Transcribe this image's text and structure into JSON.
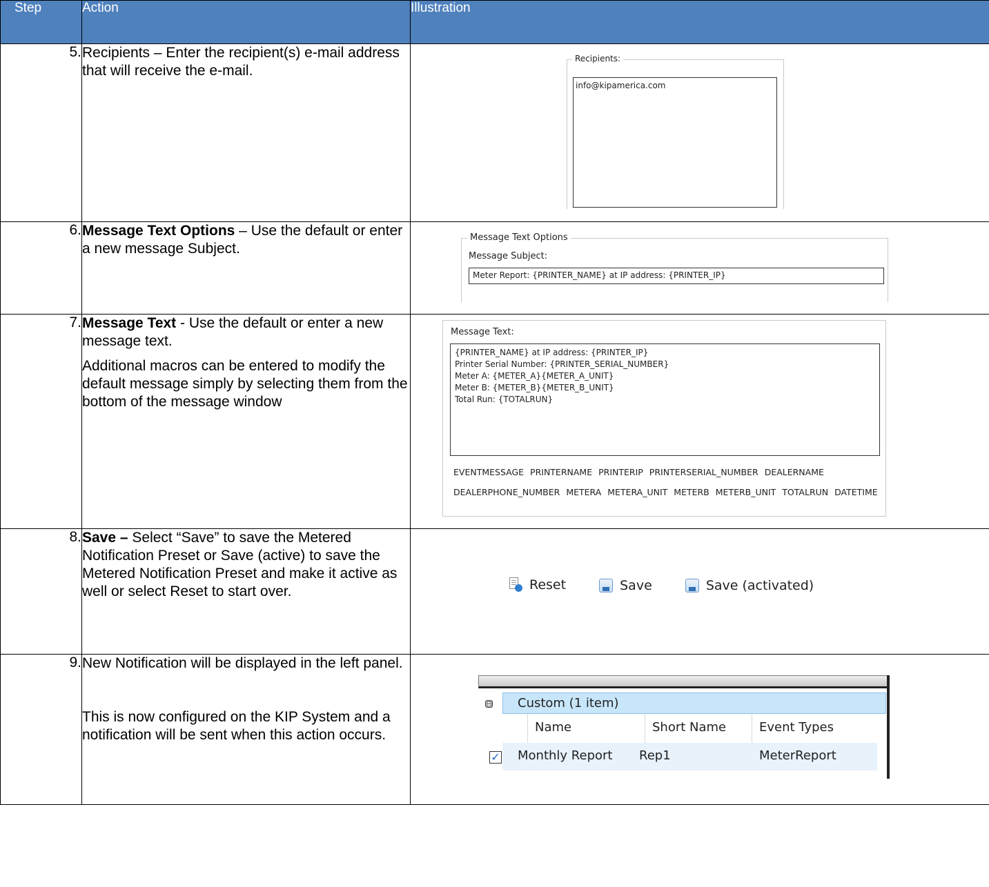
{
  "headers": {
    "step": "Step",
    "action": "Action",
    "illustration": "Illustration"
  },
  "rows": [
    {
      "step": "5.",
      "action_bold": "",
      "action_text": "Recipients – Enter the recipient(s) e-mail address that will receive the e-mail.",
      "illustration": {
        "legend": "Recipients:",
        "value": "info@kipamerica.com"
      }
    },
    {
      "step": "6.",
      "action_bold": "Message Text Options",
      "action_text": " – Use the default or enter a new message Subject.",
      "illustration": {
        "legend": "Message Text Options",
        "subject_label": "Message Subject:",
        "subject_value": "Meter Report: {PRINTER_NAME} at IP address: {PRINTER_IP}"
      }
    },
    {
      "step": "7.",
      "action_bold": "Message Text",
      "action_text": " - Use the default or enter a new message text.",
      "action_text_2": "Additional macros can be entered to modify the default message simply by selecting them from the bottom of the message window",
      "illustration": {
        "label": "Message Text:",
        "lines": [
          "{PRINTER_NAME} at IP address: {PRINTER_IP}",
          "Printer Serial Number: {PRINTER_SERIAL_NUMBER}",
          "Meter A: {METER_A}{METER_A_UNIT}",
          "Meter B: {METER_B}{METER_B_UNIT}",
          "Total Run: {TOTALRUN}"
        ],
        "macros": [
          "EVENTMESSAGE",
          "PRINTERNAME",
          "PRINTERIP",
          "PRINTERSERIAL_NUMBER",
          "DEALERNAME",
          "DEALERPHONE_NUMBER",
          "METERA",
          "METERA_UNIT",
          "METERB",
          "METERB_UNIT",
          "TOTALRUN",
          "DATETIME"
        ]
      }
    },
    {
      "step": "8.",
      "action_bold": "Save –",
      "action_text": " Select “Save” to save the Metered Notification Preset or Save (active) to save the Metered Notification Preset and make it active as well or select Reset to start over.",
      "illustration": {
        "buttons": [
          {
            "label": "Reset",
            "icon": "reset-icon"
          },
          {
            "label": "Save",
            "icon": "save-icon"
          },
          {
            "label": "Save (activated)",
            "icon": "save-icon"
          }
        ]
      }
    },
    {
      "step": "9.",
      "action_bold": "",
      "action_text": "New Notification will be displayed in the left panel.",
      "action_text_2": "This is now configured on the KIP System and a notification will be sent when this action occurs.",
      "illustration": {
        "group_toggle": "⊟",
        "group": "Custom (1 item)",
        "columns": [
          "Name",
          "Short Name",
          "Event Types"
        ],
        "row": {
          "checked": true,
          "name": "Monthly Report",
          "short_name": "Rep1",
          "event_types": "MeterReport"
        }
      }
    }
  ]
}
